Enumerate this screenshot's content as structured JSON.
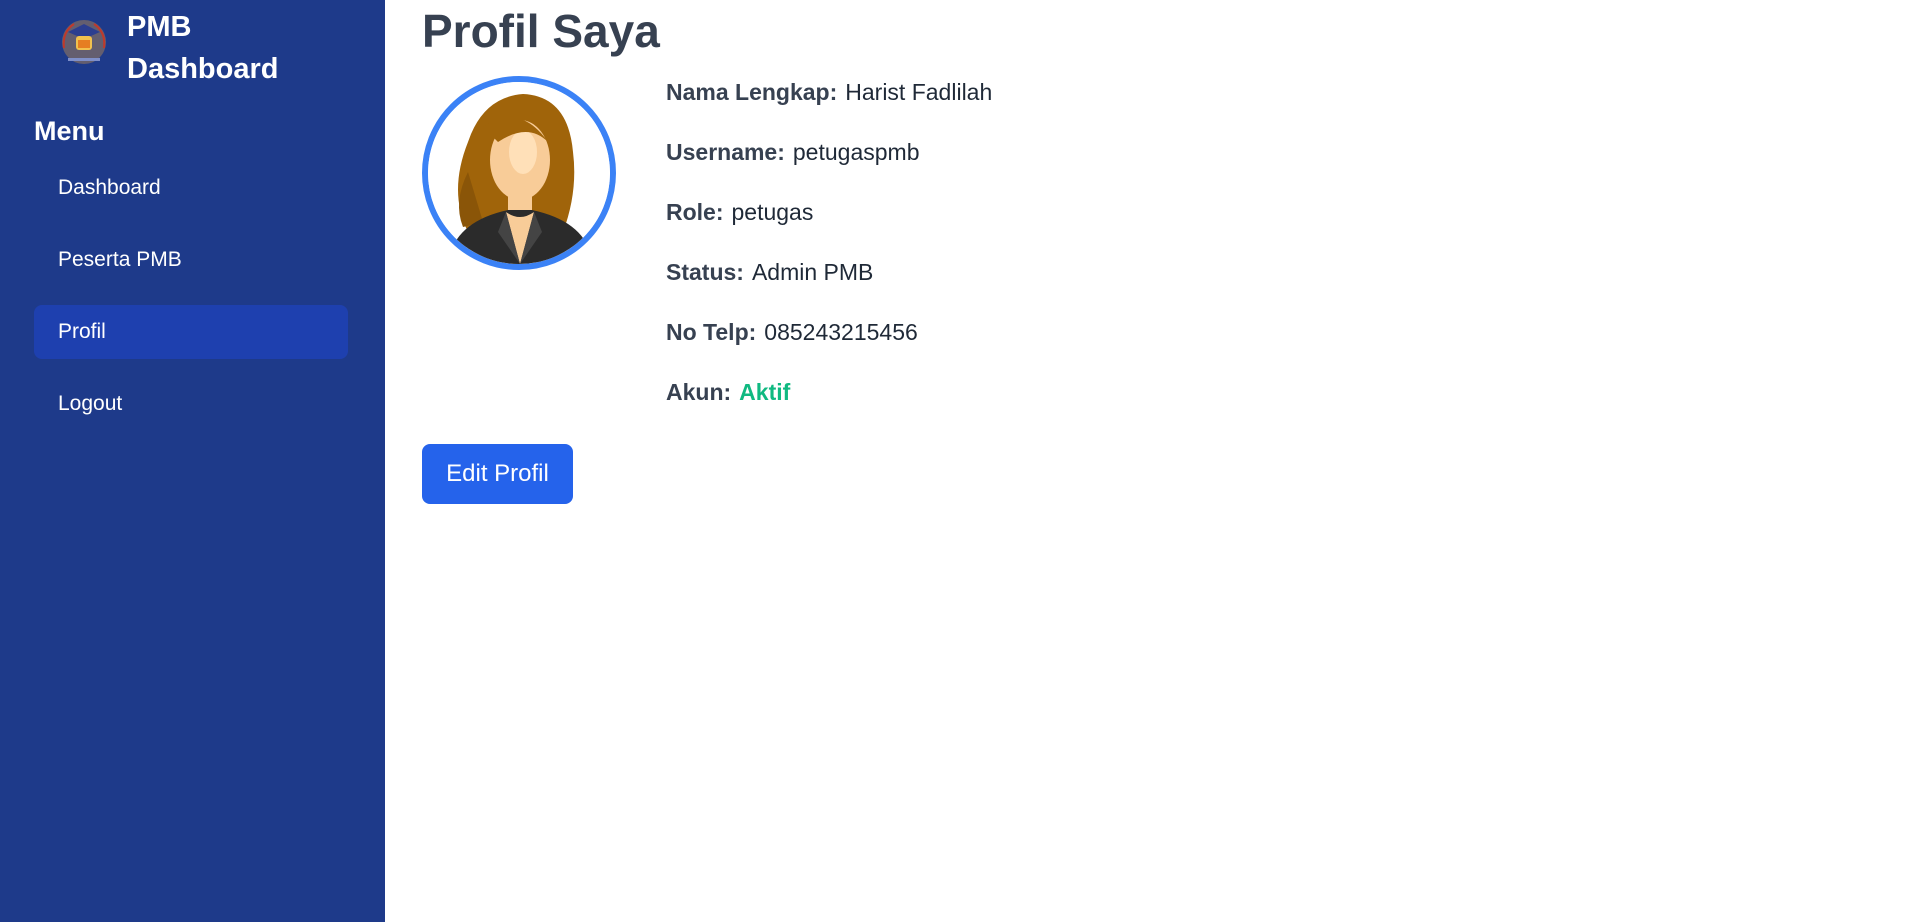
{
  "brand": {
    "title": "PMB Dashboard"
  },
  "sidebar": {
    "heading": "Menu",
    "items": [
      {
        "label": "Dashboard"
      },
      {
        "label": "Peserta PMB"
      },
      {
        "label": "Profil"
      },
      {
        "label": "Logout"
      }
    ]
  },
  "page": {
    "title": "Profil Saya"
  },
  "profile": {
    "fields": [
      {
        "label": "Nama Lengkap:",
        "value": "Harist Fadlilah"
      },
      {
        "label": "Username:",
        "value": "petugaspmb"
      },
      {
        "label": "Role:",
        "value": "petugas"
      },
      {
        "label": "Status:",
        "value": "Admin PMB"
      },
      {
        "label": "No Telp:",
        "value": "085243215456"
      },
      {
        "label": "Akun:",
        "value": "Aktif"
      }
    ]
  },
  "actions": {
    "edit_label": "Edit Profil"
  },
  "colors": {
    "sidebar_bg": "#1e3a8a",
    "active_item_bg": "#1e40af",
    "accent": "#2563eb",
    "avatar_ring": "#3b82f6",
    "status_active": "#10b981"
  }
}
